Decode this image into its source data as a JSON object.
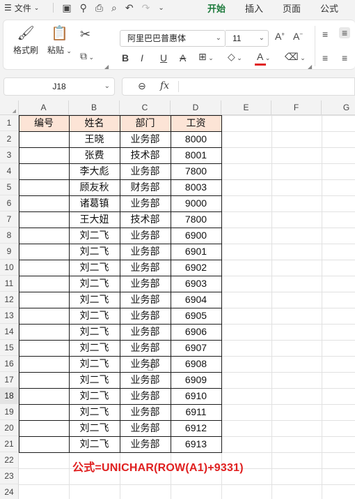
{
  "menubar": {
    "file_label": "文件",
    "tabs": [
      {
        "label": "开始",
        "active": true
      },
      {
        "label": "插入",
        "active": false
      },
      {
        "label": "页面",
        "active": false
      },
      {
        "label": "公式",
        "active": false
      }
    ]
  },
  "ribbon": {
    "format_painter": "格式刷",
    "paste": "粘贴",
    "font_name": "阿里巴巴普惠体",
    "font_size": "11"
  },
  "formula_bar": {
    "name_box": "J18",
    "formula": ""
  },
  "columns": [
    "A",
    "B",
    "C",
    "D",
    "E",
    "F",
    "G"
  ],
  "rows": [
    "1",
    "2",
    "3",
    "4",
    "5",
    "6",
    "7",
    "8",
    "9",
    "10",
    "11",
    "12",
    "13",
    "14",
    "15",
    "16",
    "17",
    "18",
    "19",
    "20",
    "21",
    "22",
    "23",
    "24"
  ],
  "selected_row": "18",
  "table": {
    "headers": [
      "编号",
      "姓名",
      "部门",
      "工资"
    ],
    "header_fill": "#fce4d6",
    "data": [
      [
        "",
        "王晓",
        "业务部",
        "8000"
      ],
      [
        "",
        "张费",
        "技术部",
        "8001"
      ],
      [
        "",
        "李大彪",
        "业务部",
        "7800"
      ],
      [
        "",
        "顾友秋",
        "财务部",
        "8003"
      ],
      [
        "",
        "诸葛镇",
        "业务部",
        "9000"
      ],
      [
        "",
        "王大妞",
        "技术部",
        "7800"
      ],
      [
        "",
        "刘二飞",
        "业务部",
        "6900"
      ],
      [
        "",
        "刘二飞",
        "业务部",
        "6901"
      ],
      [
        "",
        "刘二飞",
        "业务部",
        "6902"
      ],
      [
        "",
        "刘二飞",
        "业务部",
        "6903"
      ],
      [
        "",
        "刘二飞",
        "业务部",
        "6904"
      ],
      [
        "",
        "刘二飞",
        "业务部",
        "6905"
      ],
      [
        "",
        "刘二飞",
        "业务部",
        "6906"
      ],
      [
        "",
        "刘二飞",
        "业务部",
        "6907"
      ],
      [
        "",
        "刘二飞",
        "业务部",
        "6908"
      ],
      [
        "",
        "刘二飞",
        "业务部",
        "6909"
      ],
      [
        "",
        "刘二飞",
        "业务部",
        "6910"
      ],
      [
        "",
        "刘二飞",
        "业务部",
        "6911"
      ],
      [
        "",
        "刘二飞",
        "业务部",
        "6912"
      ],
      [
        "",
        "刘二飞",
        "业务部",
        "6913"
      ]
    ]
  },
  "annotation": "公式=UNICHAR(ROW(A1)+9331)",
  "colors": {
    "accent": "#1d7a3c",
    "annotation": "#e02020",
    "font_color_bar": "#e02020"
  }
}
